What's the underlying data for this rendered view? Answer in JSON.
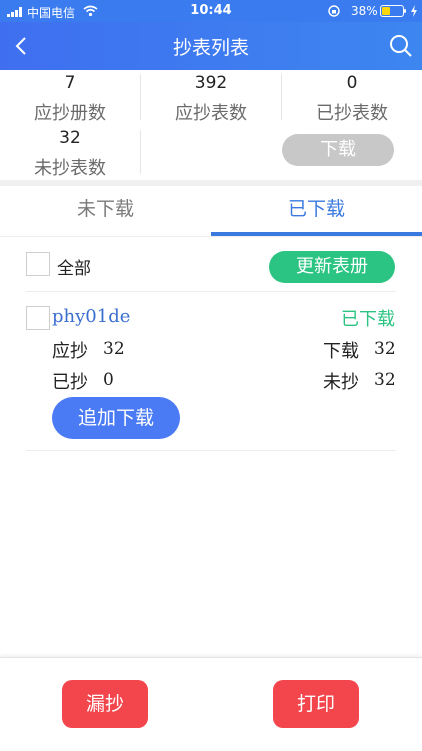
{
  "status_bar": {
    "carrier": "中国电信",
    "time": "10:44",
    "battery": "38%"
  },
  "nav": {
    "title": "抄表列表"
  },
  "stats": {
    "items": [
      {
        "value": "7",
        "label": "应抄册数"
      },
      {
        "value": "392",
        "label": "应抄表数"
      },
      {
        "value": "0",
        "label": "已抄表数"
      },
      {
        "value": "32",
        "label": "未抄表数"
      }
    ],
    "download_label": "下载"
  },
  "tabs": [
    {
      "label": "未下载",
      "active": false
    },
    {
      "label": "已下载",
      "active": true
    }
  ],
  "list_header": {
    "select_all_label": "全部",
    "update_button_label": "更新表册"
  },
  "book": {
    "name": "phy01de",
    "status": "已下载",
    "should_read_label": "应抄",
    "should_read_value": "32",
    "downloaded_label": "下载",
    "downloaded_value": "32",
    "read_label": "已抄",
    "read_value": "0",
    "unread_label": "未抄",
    "unread_value": "32",
    "append_download_label": "追加下载"
  },
  "bottom": {
    "missed_label": "漏抄",
    "print_label": "打印"
  },
  "colors": {
    "nav_blue": "#3d7cf0",
    "active_tab": "#3a7ae0",
    "green": "#2bc482",
    "red": "#f2454c",
    "pill_blue": "#4a7bf5",
    "gray_pill": "#c8c8c8"
  }
}
